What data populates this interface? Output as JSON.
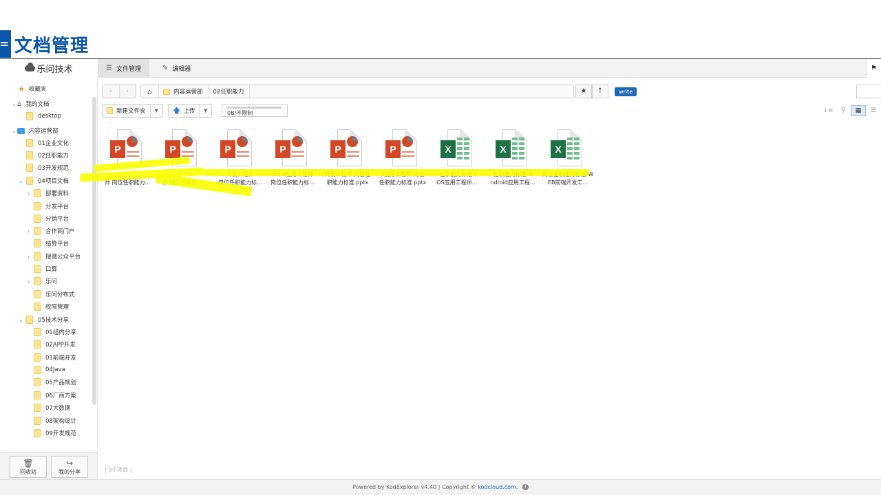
{
  "slide": {
    "title": "文档管理"
  },
  "app": {
    "brand": "乐问技术",
    "tabs": [
      {
        "label": "文件管理",
        "icon": "list-icon"
      },
      {
        "label": "编辑器",
        "icon": "edit-icon"
      }
    ],
    "flag_icon": "flag-icon"
  },
  "sidebar": {
    "favorites": "收藏夹",
    "my_docs": "我的文档",
    "desktop": "desktop",
    "group": "内容运营部",
    "group_children": [
      "01企业文化",
      "02任职能力",
      "03开发规范",
      "04项目文档"
    ],
    "project_children": [
      "部署资料",
      "分发平台",
      "分销平台",
      "合作商门户",
      "结算平台",
      "搜微公众平台",
      "口算",
      "乐问",
      "乐问分布式",
      "权限管理"
    ],
    "tech_share": "05技术分享",
    "tech_children": [
      "01组内分享",
      "02APP开发",
      "03前端开发",
      "04Java",
      "05产品规划",
      "06厂商方案",
      "07大数据",
      "08架构设计",
      "09开发规范"
    ],
    "recycle_label": "回收站",
    "share_label": "我的分享"
  },
  "path": {
    "crumbs": [
      "内容运营部",
      "02任职能力"
    ],
    "badge": "write"
  },
  "toolbar": {
    "new_folder": "新建文件夹",
    "upload": "上传",
    "quota": "0B/不限制"
  },
  "files": [
    {
      "type": "ppt",
      "line1": "",
      "line2": "师 岗位任职能力..."
    },
    {
      "type": "ppt",
      "line1": "",
      "line2": "师 岗位任职能..."
    },
    {
      "type": "ppt",
      "line1": "...开发工程师",
      "line2": "...岗位任职能力标..."
    },
    {
      "type": "ppt",
      "line1": "droid应用工程师",
      "line2": "岗位任职能力标..."
    },
    {
      "type": "ppt",
      "line1": "开发工程师 岗位任",
      "line2": "职能力标准.pptx"
    },
    {
      "type": "ppt",
      "line1": "S应用工程师 岗位",
      "line2": "任职能力标准.pptx"
    },
    {
      "type": "xls",
      "line1": "任职能力标准-i",
      "line2": "OS应用工程师...."
    },
    {
      "type": "xls",
      "line1": "任职能力标准-A",
      "line2": "ndroid应用工程..."
    },
    {
      "type": "xls",
      "line1": "岗位任职能力标准-W",
      "line2": "EB前端开发工..."
    }
  ],
  "status": {
    "count": "| 9个项目 |"
  },
  "footer": {
    "powered": "Powered by KodExplorer v4.40 | Copyright ©",
    "link": "kodcloud.com",
    "tail": "."
  },
  "colors": {
    "accent": "#0a56a8",
    "badge": "#1d68b8",
    "ppt": "#d24726",
    "xls": "#1e7145",
    "highlight": "#f9ff00"
  }
}
